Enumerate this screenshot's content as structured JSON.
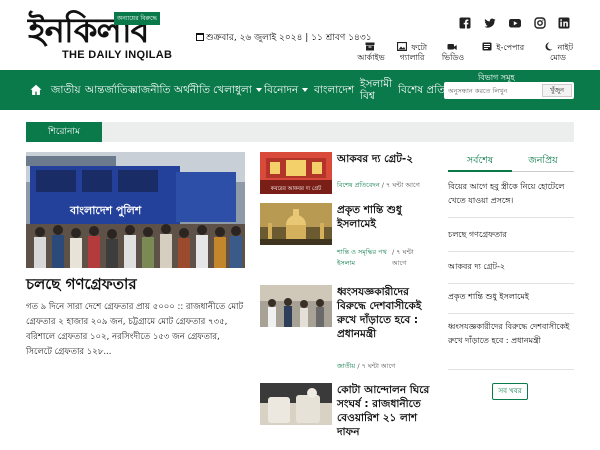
{
  "site": {
    "logo_text": "ইনকিলাব",
    "logo_tag": "অন্যায়ের বিরুদ্ধে",
    "logo_sub": "THE DAILY INQILAB",
    "date": "শুক্রবার, ২৬ জুলাই ২০২৪ | ১১ শ্রাবণ ১৪৩১"
  },
  "social": [
    "facebook-icon",
    "twitter-icon",
    "youtube-icon",
    "instagram-icon",
    "linkedin-icon"
  ],
  "tools": [
    {
      "label": "আর্কাইভ",
      "icon": "archive-icon"
    },
    {
      "label": "ফটো গ্যালারি",
      "icon": "photo-icon"
    },
    {
      "label": "ভিডিও",
      "icon": "video-icon"
    },
    {
      "label": "ই-পেপার",
      "icon": "epaper-icon"
    },
    {
      "label": "নাইট মোড",
      "icon": "moon-icon"
    }
  ],
  "nav": {
    "items": [
      "জাতীয়",
      "আন্তর্জাতিক",
      "রাজনীতি",
      "অর্থনীতি",
      "খেলাধুলা",
      "বিনোদন",
      "বাংলাদেশ",
      "ইসলামী বিশ্ব",
      "বিশেষ প্রতিবেদন",
      "বিভাগ সমূহ"
    ],
    "search_placeholder": "অনুসন্ধান করতে লিখুন",
    "search_button": "খুঁজুন"
  },
  "headline_label": "শিরোনাম",
  "lead": {
    "image_text": "বাংলাদেশ পুলিশ",
    "title": "চলছে গণগ্রেফতার",
    "summary": "গত ৯ দিনে সারা দেশে গ্রেফতার প্রায় ৫০০০ :: রাজধানীতে মোট গ্রেফতার ২ হাজার ২০৯ জন, চট্টগ্রামে মোট গ্রেফতার ৭৩৫, বরিশালে গ্রেফতার ১০২, নরসিংদীতে ১৫৩ জন গ্রেফতার, সিলেটে গ্রেফতার ১২৮..."
  },
  "middle": [
    {
      "title": "আকবর দ্য গ্রেট-২",
      "category": "বিশেষ প্রতিবেদন",
      "time": "৭ ঘন্টা আগে",
      "thumb_text": "কবরের আকবর দ্য গ্রেট"
    },
    {
      "title": "প্রকৃত শান্তি শুধু ইসলামেই",
      "category": "শান্তি ও সমৃদ্ধির পথ ইসলাম",
      "time": "৭ ঘন্টা আগে"
    },
    {
      "title": "ধ্বংসযজ্ঞকারীদের বিরুদ্ধে দেশবাসীকেই রুখে দাঁড়াতে হবে : প্রধানমন্ত্রী",
      "category": "জাতীয়",
      "time": "৭ ঘন্টা আগে"
    },
    {
      "title": "কোটা আন্দোলন ঘিরে সংঘর্ষ : রাজধানীতে বেওয়ারিশ ২১ লাশ দাফন",
      "category": "",
      "time": ""
    }
  ],
  "sidebar": {
    "tab_latest": "সর্বশেষ",
    "tab_popular": "জনপ্রিয়",
    "items": [
      "বিয়ের আগে হবু স্ত্রীকে নিয়ে হোটেলে খেতে যাওয়া প্রসঙ্গে।",
      "চলছে গণগ্রেফতার",
      "আকবর দ্য গ্রেট-২",
      "প্রকৃত শান্তি শুধু ইসলামেই",
      "ধ্বংসযজ্ঞকারীদের বিরুদ্ধে দেশবাসীকেই রুখে দাঁড়াতে হবে : প্রধানমন্ত্রী"
    ],
    "all_news": "সব খবর"
  },
  "colors": {
    "brand_green": "#0b7a4b",
    "headline_bar": "#eceeee",
    "police_blue": "#23409a"
  }
}
